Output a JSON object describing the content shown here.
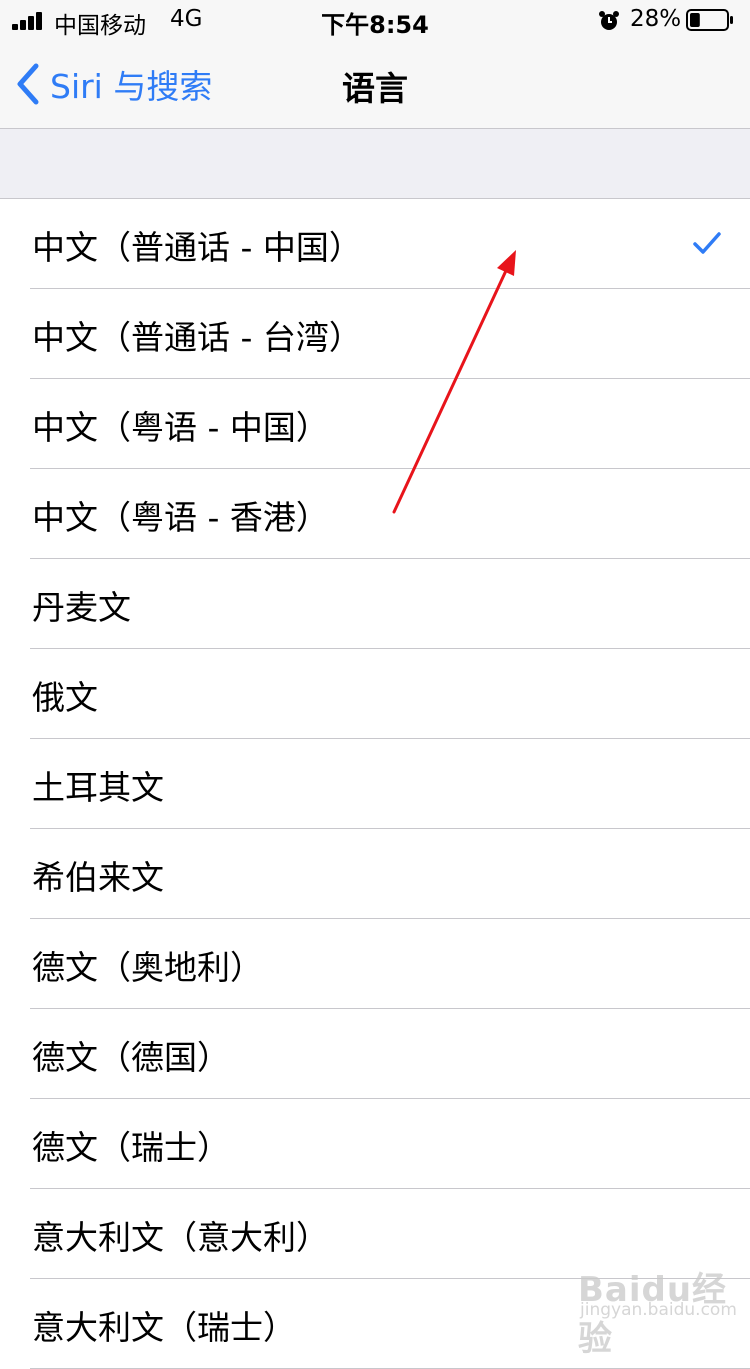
{
  "status_bar": {
    "carrier": "中国移动",
    "network": "4G",
    "time": "下午8:54",
    "battery_percent": "28%",
    "battery_level": 0.28,
    "alarm_icon": "alarm-clock-icon"
  },
  "nav": {
    "back_label": "Siri 与搜索",
    "title": "语言",
    "accent_color": "#2f7cf6"
  },
  "languages": [
    {
      "label": "中文（普通话 - 中国）",
      "selected": true
    },
    {
      "label": "中文（普通话 - 台湾）",
      "selected": false
    },
    {
      "label": "中文（粤语 - 中国）",
      "selected": false
    },
    {
      "label": "中文（粤语 - 香港）",
      "selected": false
    },
    {
      "label": "丹麦文",
      "selected": false
    },
    {
      "label": "俄文",
      "selected": false
    },
    {
      "label": "土耳其文",
      "selected": false
    },
    {
      "label": "希伯来文",
      "selected": false
    },
    {
      "label": "德文（奥地利）",
      "selected": false
    },
    {
      "label": "德文（德国）",
      "selected": false
    },
    {
      "label": "德文（瑞士）",
      "selected": false
    },
    {
      "label": "意大利文（意大利）",
      "selected": false
    },
    {
      "label": "意大利文（瑞士）",
      "selected": false
    }
  ],
  "annotation": {
    "arrow_color": "#e8141b"
  },
  "watermark": {
    "logo": "Baidu经验",
    "url": "jingyan.baidu.com"
  }
}
